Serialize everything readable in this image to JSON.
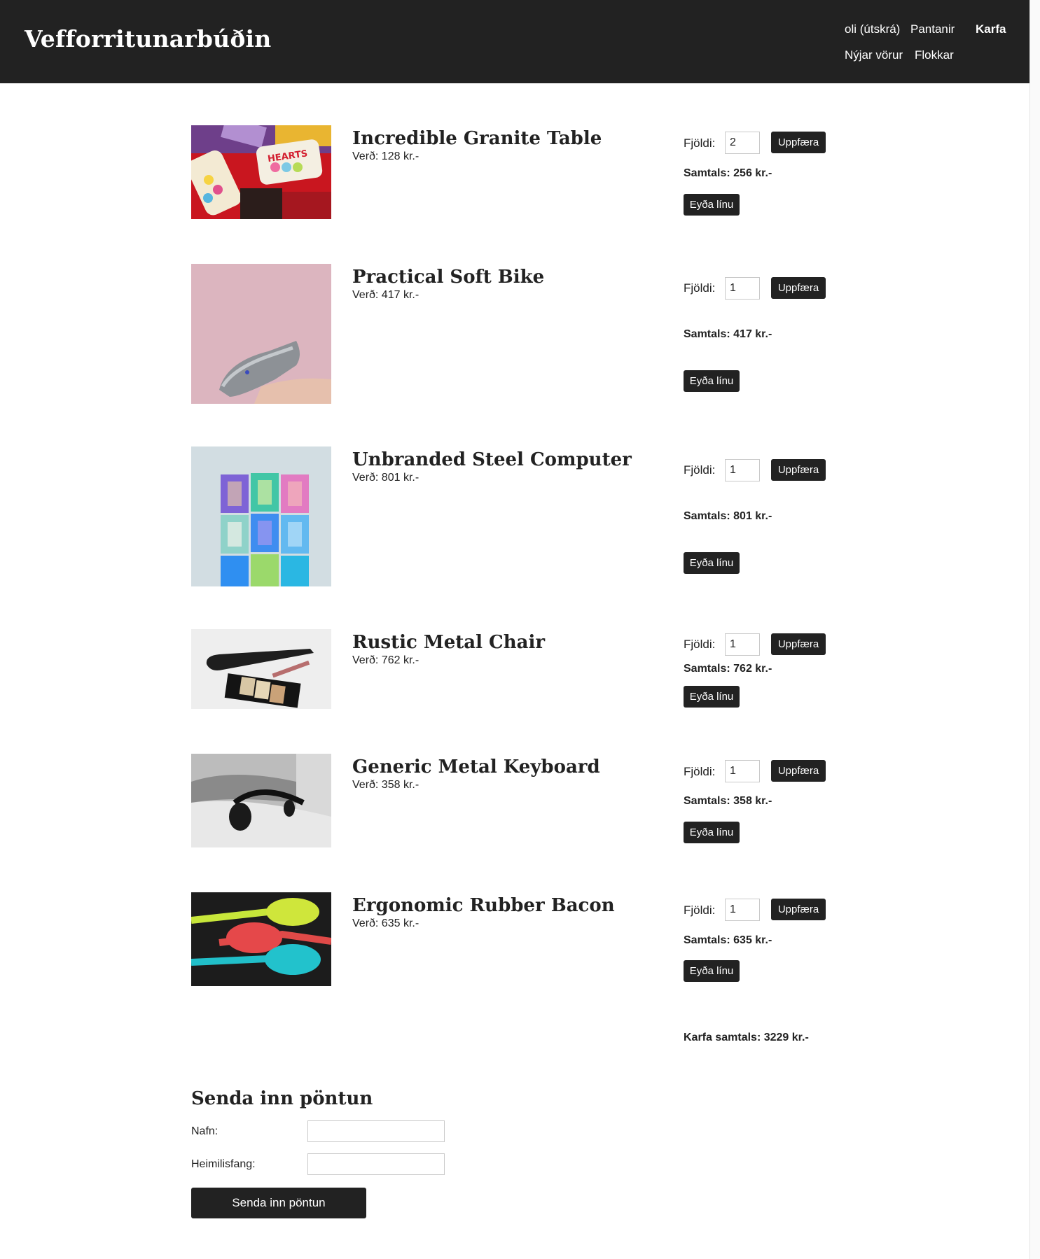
{
  "header": {
    "title": "Vefforritunarbúðin",
    "nav": {
      "user_logout": "oli (útskrá)",
      "orders": "Pantanir",
      "cart": "Karfa",
      "new_products": "Nýjar vörur",
      "categories": "Flokkar"
    }
  },
  "cart": {
    "qty_label": "Fjöldi:",
    "update_label": "Uppfæra",
    "delete_label": "Eyða línu",
    "items": [
      {
        "name": "Incredible Granite Table",
        "price_text": "Verð: 128 kr.-",
        "qty": "2",
        "total_text": "Samtals: 256 kr.-",
        "image": "candy-photo"
      },
      {
        "name": "Practical Soft Bike",
        "price_text": "Verð: 417 kr.-",
        "qty": "1",
        "total_text": "Samtals: 417 kr.-",
        "image": "hair-dryer-photo"
      },
      {
        "name": "Unbranded Steel Computer",
        "price_text": "Verð: 801 kr.-",
        "qty": "1",
        "total_text": "Samtals: 801 kr.-",
        "image": "colorful-boxes-photo"
      },
      {
        "name": "Rustic Metal Chair",
        "price_text": "Verð: 762 kr.-",
        "qty": "1",
        "total_text": "Samtals: 762 kr.-",
        "image": "hair-straightener-photo"
      },
      {
        "name": "Generic Metal Keyboard",
        "price_text": "Verð: 358 kr.-",
        "qty": "1",
        "total_text": "Samtals: 358 kr.-",
        "image": "headphones-photo"
      },
      {
        "name": "Ergonomic Rubber Bacon",
        "price_text": "Verð: 635 kr.-",
        "qty": "1",
        "total_text": "Samtals: 635 kr.-",
        "image": "spoons-photo"
      }
    ],
    "grand_total_text": "Karfa samtals: 3229 kr.-"
  },
  "order_form": {
    "heading": "Senda inn pöntun",
    "name_label": "Nafn:",
    "address_label": "Heimilisfang:",
    "name_value": "",
    "address_value": "",
    "submit_label": "Senda inn pöntun"
  },
  "colors": {
    "header_bg": "#222222",
    "button_bg": "#222222",
    "text": "#222222"
  }
}
